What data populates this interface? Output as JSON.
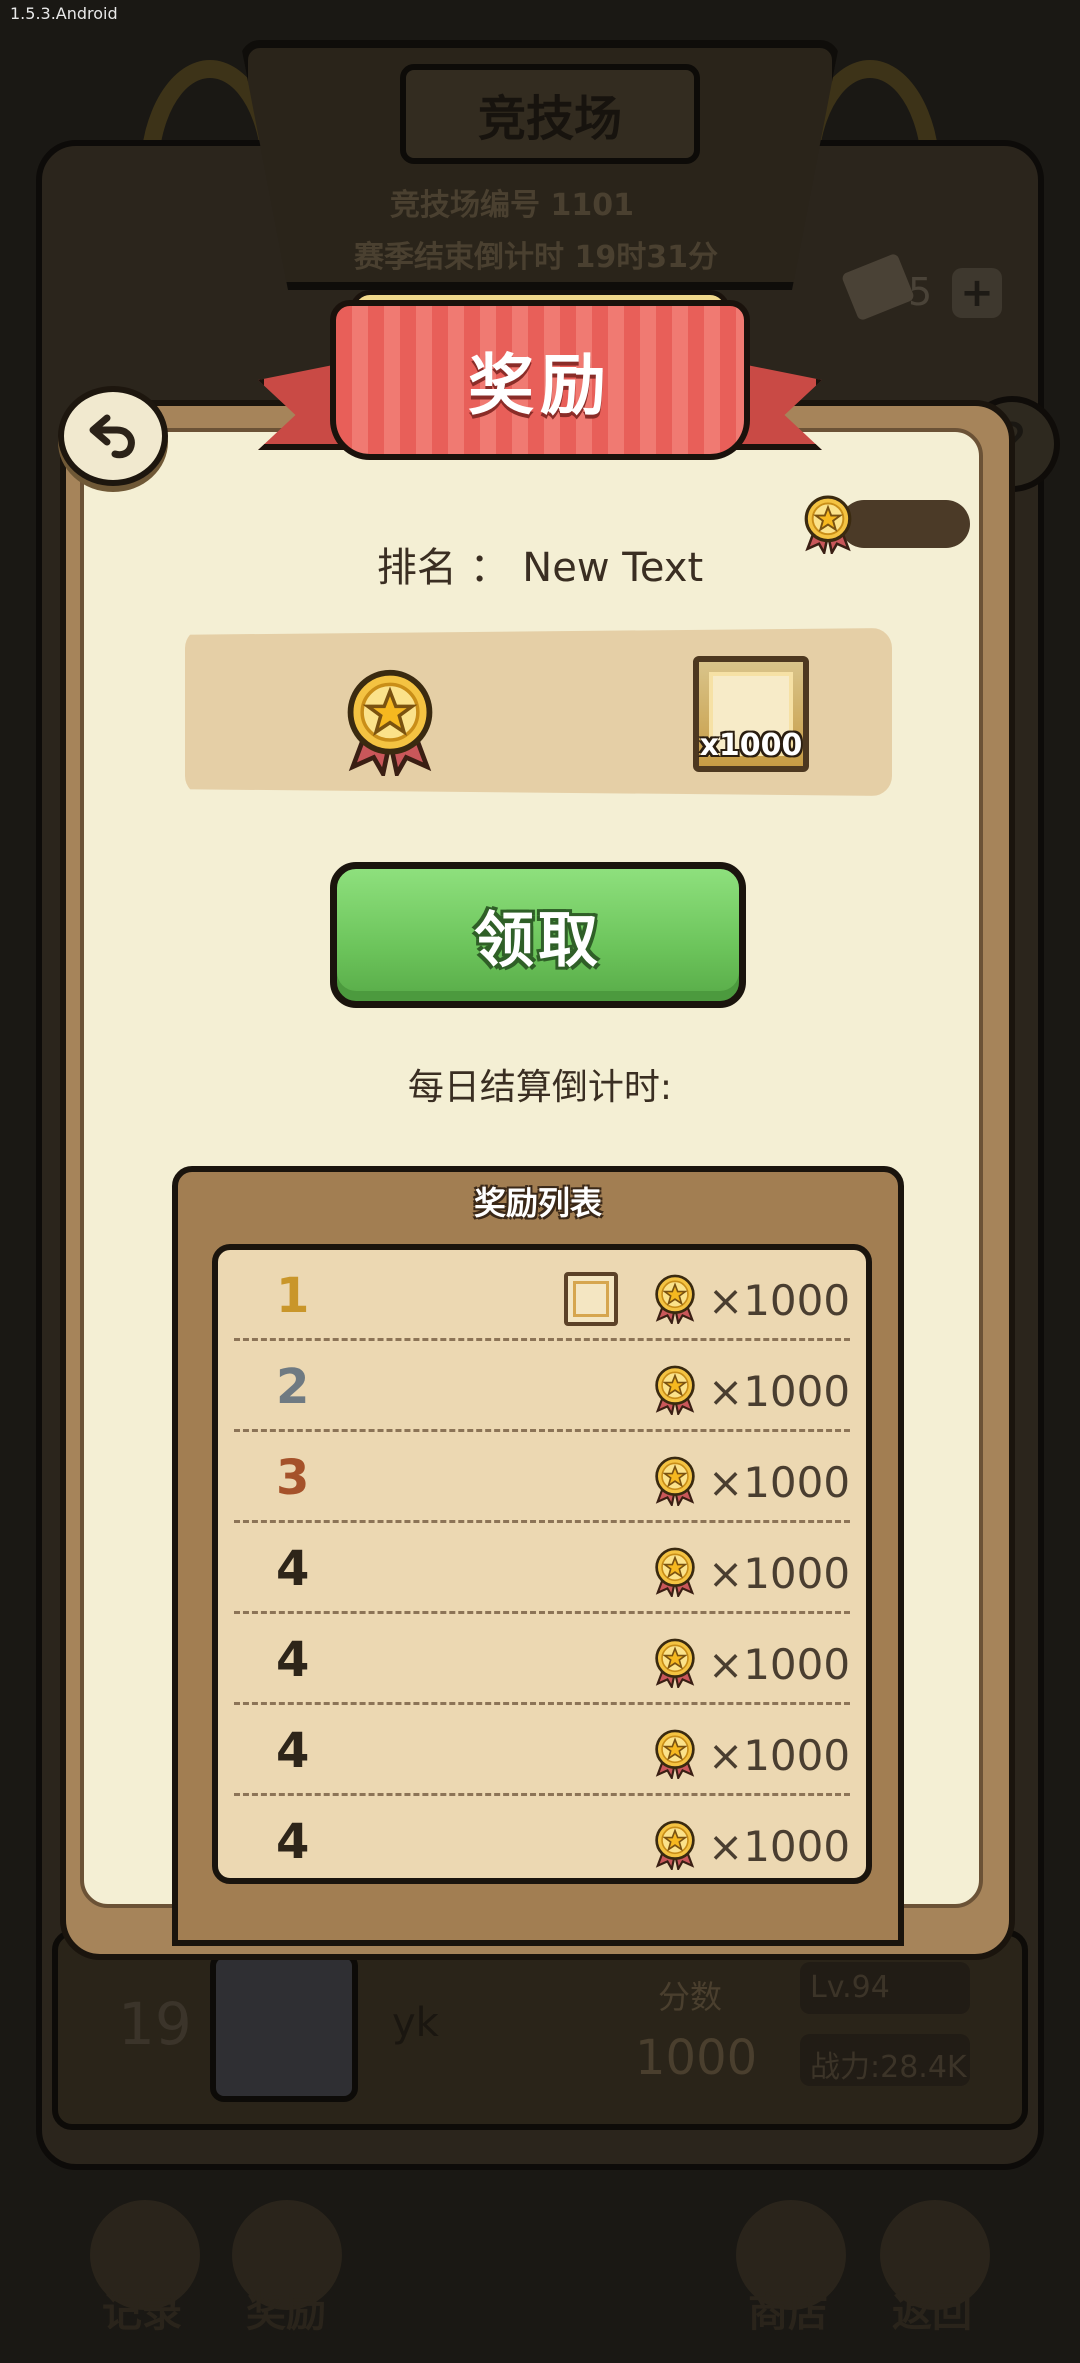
{
  "status_bar": {
    "text": "1.5.3.Android"
  },
  "background": {
    "title": "竞技场",
    "arena_id_text": "竞技场编号 1101",
    "season_countdown_text": "赛季结束倒计时 19时31分",
    "ticket_count": "5",
    "plus_label": "+",
    "help_label": "?",
    "player_row": {
      "rank": "19",
      "name": "yk",
      "score_label": "分数",
      "score": "1000",
      "level": "Lv.94",
      "power": "战力:28.4K"
    },
    "nav": {
      "record": "记录",
      "reward": "奖励",
      "shop": "商店",
      "back": "返回"
    }
  },
  "modal": {
    "title": "奖励",
    "rank_label": "排名",
    "rank_separator": "：",
    "rank_value": "New Text",
    "reward_amount": "x1000",
    "claim_label": "领取",
    "countdown_label": "每日结算倒计时:",
    "list_title": "奖励列表",
    "rows": [
      {
        "rank": "1",
        "rank_color": "#c9962a",
        "has_frame": true,
        "amount": "×1000"
      },
      {
        "rank": "2",
        "rank_color": "#6f7a82",
        "has_frame": false,
        "amount": "×1000"
      },
      {
        "rank": "3",
        "rank_color": "#a5522a",
        "has_frame": false,
        "amount": "×1000"
      },
      {
        "rank": "4",
        "rank_color": "#2e2519",
        "has_frame": false,
        "amount": "×1000"
      },
      {
        "rank": "4",
        "rank_color": "#2e2519",
        "has_frame": false,
        "amount": "×1000"
      },
      {
        "rank": "4",
        "rank_color": "#2e2519",
        "has_frame": false,
        "amount": "×1000"
      },
      {
        "rank": "4",
        "rank_color": "#2e2519",
        "has_frame": false,
        "amount": "×1000"
      }
    ]
  },
  "icons": {
    "medal": "star-medal-icon",
    "frame": "avatar-frame-icon",
    "back": "back-arrow-icon"
  }
}
